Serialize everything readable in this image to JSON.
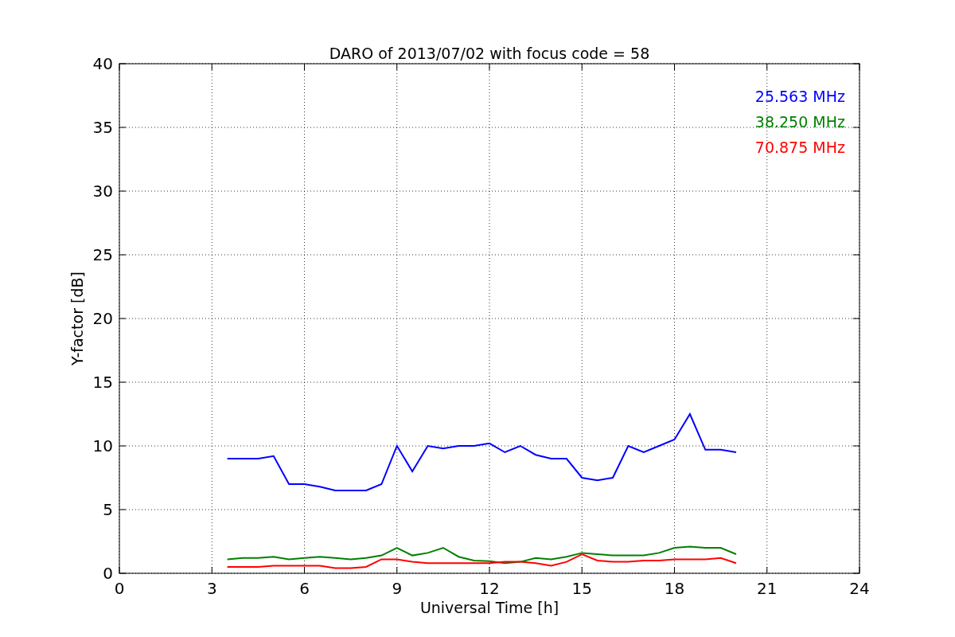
{
  "figure": {
    "chart_data": {
      "type": "line",
      "title": "DARO of 2013/07/02 with focus code = 58",
      "xlabel": "Universal Time [h]",
      "ylabel": "Y-factor [dB]",
      "x": [
        3.5,
        4,
        4.5,
        5,
        5.5,
        6,
        6.5,
        7,
        7.5,
        8,
        8.5,
        9,
        9.5,
        10,
        10.5,
        11,
        11.5,
        12,
        12.5,
        13,
        13.5,
        14,
        14.5,
        15,
        15.5,
        16,
        16.5,
        17,
        17.5,
        18,
        18.5,
        19,
        19.5,
        20
      ],
      "series": [
        {
          "name": "25.563 MHz",
          "color": "#0000ff",
          "values": [
            9,
            9,
            9,
            9.2,
            7,
            7,
            6.8,
            6.5,
            6.5,
            6.5,
            7,
            10,
            8,
            10,
            9.8,
            10,
            10,
            10.2,
            9.5,
            10,
            9.3,
            9,
            9,
            7.5,
            7.3,
            7.5,
            10,
            9.5,
            10,
            10.5,
            12.5,
            9.7,
            9.7,
            9.5
          ]
        },
        {
          "name": "38.250 MHz",
          "color": "#008000",
          "values": [
            1.1,
            1.2,
            1.2,
            1.3,
            1.1,
            1.2,
            1.3,
            1.2,
            1.1,
            1.2,
            1.4,
            2,
            1.4,
            1.6,
            2,
            1.3,
            1,
            0.95,
            0.8,
            0.9,
            1.2,
            1.1,
            1.3,
            1.6,
            1.5,
            1.4,
            1.4,
            1.4,
            1.6,
            2,
            2.1,
            2,
            2,
            1.5
          ]
        },
        {
          "name": "70.875 MHz",
          "color": "#ff0000",
          "values": [
            0.5,
            0.5,
            0.5,
            0.6,
            0.6,
            0.6,
            0.6,
            0.4,
            0.4,
            0.5,
            1.1,
            1.1,
            0.9,
            0.8,
            0.8,
            0.8,
            0.8,
            0.8,
            0.9,
            0.9,
            0.8,
            0.6,
            0.9,
            1.5,
            1,
            0.9,
            0.9,
            1,
            1,
            1.1,
            1.1,
            1.1,
            1.2,
            0.8
          ]
        }
      ],
      "grid": true,
      "xlim": [
        0,
        24
      ],
      "ylim": [
        0,
        40
      ],
      "xticks": [
        0,
        3,
        6,
        9,
        12,
        15,
        18,
        21,
        24
      ],
      "yticks": [
        0,
        5,
        10,
        15,
        20,
        25,
        30,
        35,
        40
      ]
    }
  }
}
